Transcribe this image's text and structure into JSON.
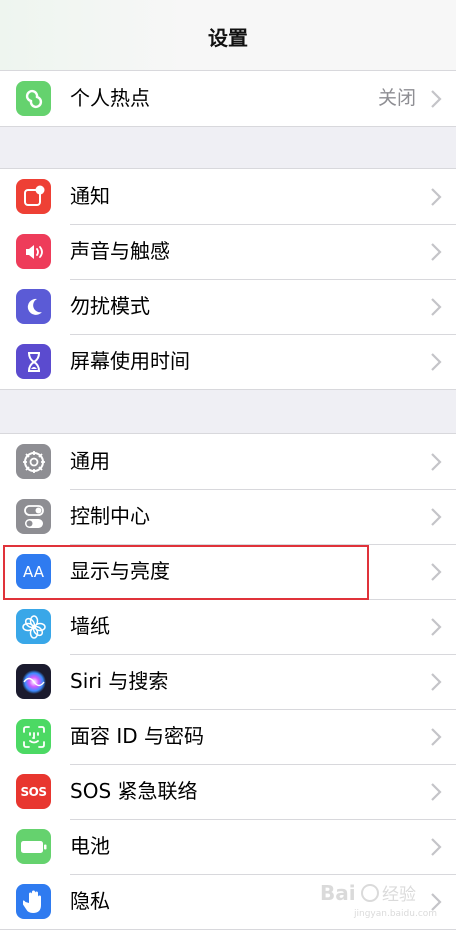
{
  "header": {
    "title": "设置"
  },
  "groups": [
    {
      "items": [
        {
          "label": "个人热点",
          "value": "关闭",
          "icon": "hotspot-icon",
          "color": "#65d26e"
        }
      ]
    },
    {
      "items": [
        {
          "label": "通知",
          "icon": "notifications-icon",
          "color": "#ee4035"
        },
        {
          "label": "声音与触感",
          "icon": "sound-icon",
          "color": "#ee3c5a"
        },
        {
          "label": "勿扰模式",
          "icon": "moon-icon",
          "color": "#5b5bd6"
        },
        {
          "label": "屏幕使用时间",
          "icon": "hourglass-icon",
          "color": "#5b4bcf"
        }
      ]
    },
    {
      "items": [
        {
          "label": "通用",
          "icon": "gear-icon",
          "color": "#8e8e93"
        },
        {
          "label": "控制中心",
          "icon": "toggles-icon",
          "color": "#8e8e93"
        },
        {
          "label": "显示与亮度",
          "icon": "text-size-icon",
          "color": "#2f7bf0",
          "iconText": "AA"
        },
        {
          "label": "墙纸",
          "icon": "flower-icon",
          "color": "#39a7e8"
        },
        {
          "label": "Siri 与搜索",
          "icon": "siri-icon",
          "color": "#1b1b2e"
        },
        {
          "label": "面容 ID 与密码",
          "icon": "face-id-icon",
          "color": "#4cd964"
        },
        {
          "label": "SOS 紧急联络",
          "icon": "sos-icon",
          "color": "#e8362f",
          "iconText": "SOS"
        },
        {
          "label": "电池",
          "icon": "battery-icon",
          "color": "#65d26e"
        },
        {
          "label": "隐私",
          "icon": "hand-icon",
          "color": "#2f7bf0"
        }
      ]
    }
  ],
  "watermark": {
    "line1": "Bai",
    "line2": "经验",
    "line3": "jingyan.baidu.com"
  }
}
